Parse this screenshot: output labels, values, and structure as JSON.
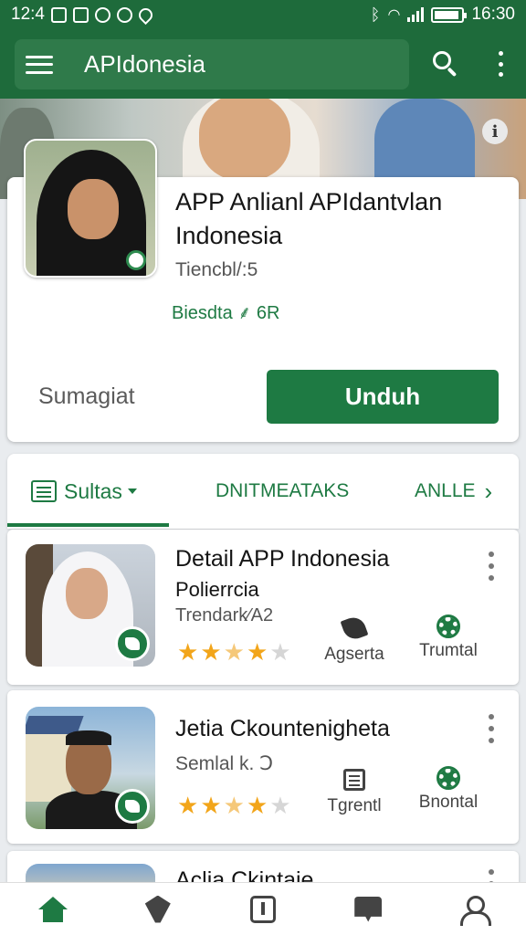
{
  "status_bar": {
    "time_left": "12:4",
    "time_right": "16:30"
  },
  "app_bar": {
    "title": "APIdonesia"
  },
  "featured": {
    "title": "APP Anlianl APIdantvlan Indonesia",
    "subtitle": "Tiencbl/:5",
    "size": "Biesdta ⸙ 6R",
    "secondary_label": "Sumagiat",
    "download_label": "Unduh"
  },
  "tabs": [
    {
      "label": "Sultas",
      "icon": "list-icon",
      "active": true
    },
    {
      "label": "DNITMEATAKS"
    },
    {
      "label": "ANLLE"
    }
  ],
  "list": [
    {
      "title": "Detail APP Indonesia",
      "subtitle": "Polierrcia",
      "meta": "Trendark⁄A2",
      "rating": 4,
      "action1": {
        "label": "Agserta",
        "icon": "leaf-icon"
      },
      "action2": {
        "label": "Trumtal",
        "icon": "gear-icon"
      }
    },
    {
      "title": "Jetia Ckountenigheta",
      "subtitle": "",
      "meta": "Semlal k. Ↄ",
      "rating": 4,
      "action1": {
        "label": "Tgrentl",
        "icon": "document-icon"
      },
      "action2": {
        "label": "Bnontal",
        "icon": "gear-icon"
      }
    },
    {
      "title": "Aclia Ckintaie"
    }
  ],
  "colors": {
    "primary": "#1e6b3b",
    "accent": "#1e7a43",
    "star": "#f2a51a"
  },
  "bottom_nav": [
    "home-icon",
    "gem-icon",
    "document-icon",
    "chat-icon",
    "profile-icon"
  ]
}
